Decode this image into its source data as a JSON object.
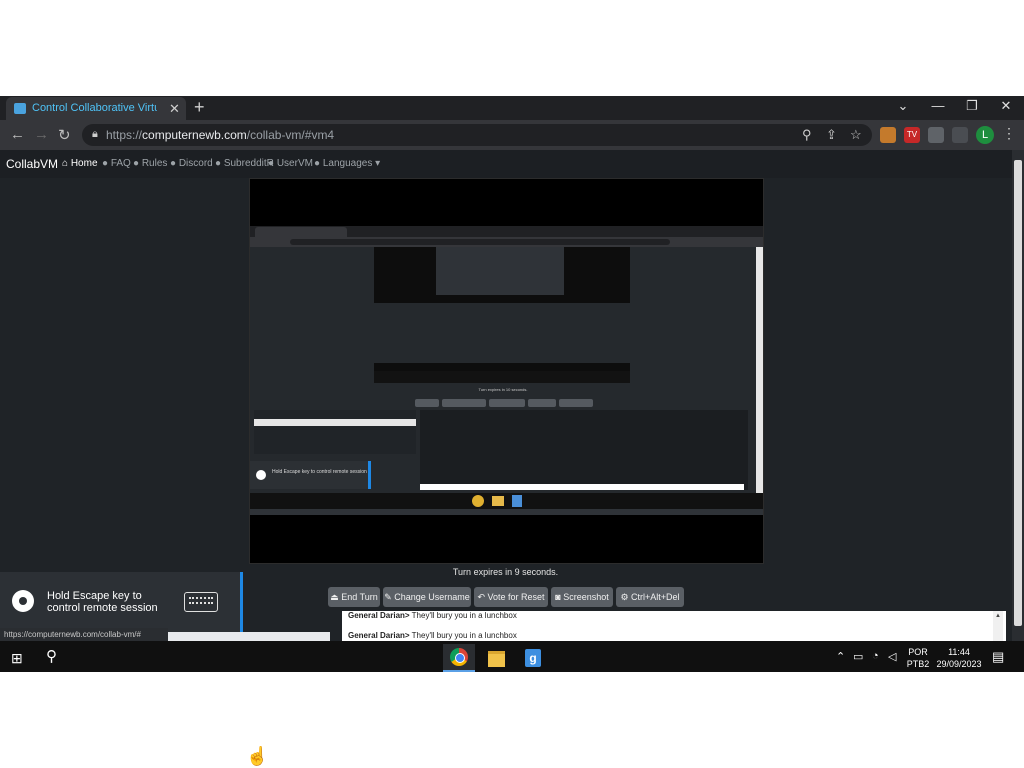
{
  "browser": {
    "tab_title": "Control Collaborative Virtual M",
    "url_scheme": "https://",
    "url_host": "computernewb.com",
    "url_path": "/collab-vm/#vm4",
    "new_tab": "+",
    "close": "✕",
    "back": "←",
    "forward": "→",
    "reload": "↻",
    "profile_initial": "L"
  },
  "site": {
    "brand": "CollabVM",
    "nav": [
      {
        "label": "Home",
        "icon": "home-icon"
      },
      {
        "label": "FAQ",
        "icon": "question-icon"
      },
      {
        "label": "Rules",
        "icon": "rules-icon"
      },
      {
        "label": "Discord",
        "icon": "discord-icon"
      },
      {
        "label": "SubredditR",
        "icon": "reddit-icon"
      },
      {
        "label": "UserVM",
        "icon": "uservm-icon"
      },
      {
        "label": "Languages ▾",
        "icon": "globe-icon"
      }
    ]
  },
  "vm": {
    "turn_text": "Turn expires in 9 seconds.",
    "inner_turn_text": "Turn expires in 10 seconds.",
    "inner_toast": "Hold Escape key to control remote session"
  },
  "controls": {
    "end_turn": "End Turn",
    "change_username": "Change Username",
    "vote_reset": "Vote for Reset",
    "screenshot": "Screenshot",
    "ctrl_alt_del": "Ctrl+Alt+Del"
  },
  "chat": {
    "messages": [
      {
        "user": "General Darian>",
        "text": " They'll bury you in a lunchbox"
      },
      {
        "user": "General Darian>",
        "text": " They'll bury you in a lunchbox"
      }
    ]
  },
  "status_url": "https://computernewb.com/collab-vm/#",
  "toast": {
    "line1": "Hold Escape key to",
    "line2": "control remote session"
  },
  "taskbar": {
    "lang_top": "POR",
    "lang_bottom": "PTB2",
    "time": "11:44",
    "date": "29/09/2023"
  },
  "colors": {
    "accent": "#1e88e5",
    "window_bg": "#1f2327",
    "button_bg": "#5a5f65"
  }
}
